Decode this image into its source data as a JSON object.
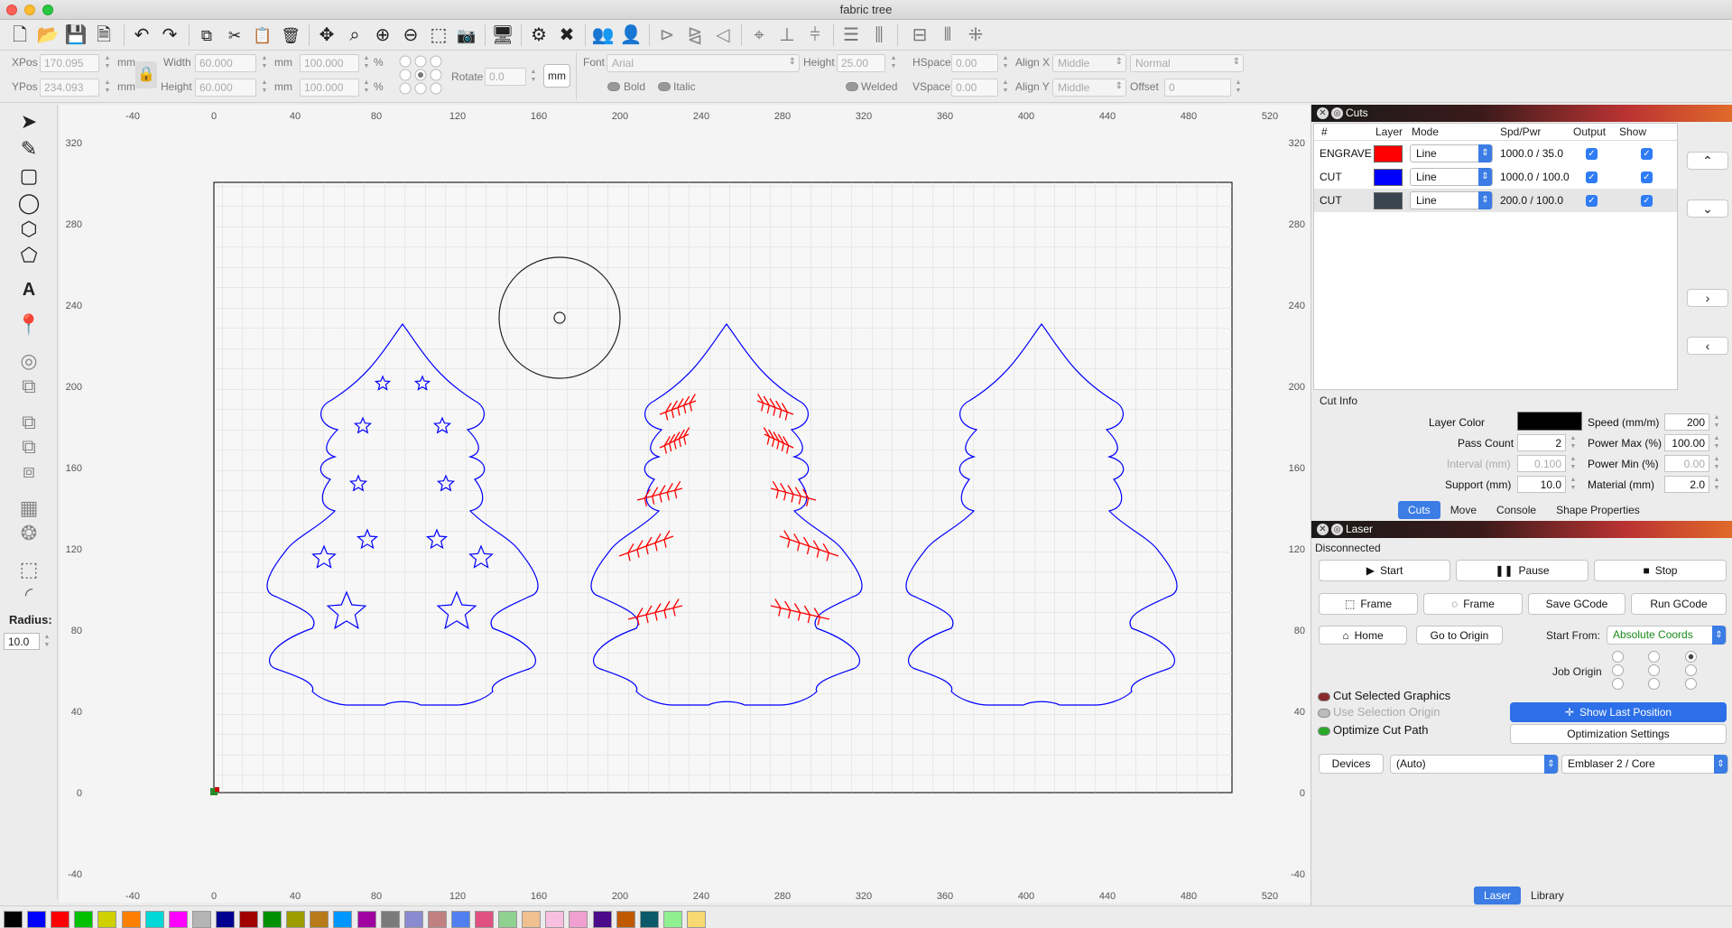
{
  "window": {
    "title": "fabric tree"
  },
  "toolbar": {
    "icons": [
      "new-file-icon",
      "open-file-icon",
      "save-icon",
      "save-as-icon",
      "undo-icon",
      "redo-icon",
      "copy-icon",
      "cut-icon",
      "paste-icon",
      "delete-icon",
      "move-icon",
      "zoom-fit-icon",
      "zoom-in-icon",
      "zoom-out-icon",
      "select-frame-icon",
      "camera-icon",
      "monitor-icon",
      "settings-icon",
      "tools-icon",
      "group-icon",
      "user-icon",
      "flip-h-icon",
      "mirror-icon",
      "arrange-icon",
      "target-icon",
      "align-left-icon",
      "align-center-icon",
      "dist-h-icon",
      "dist-v-icon",
      "resize-icon",
      "align-v-icon",
      "snap-icon"
    ]
  },
  "props": {
    "xpos_label": "XPos",
    "xpos_value": "170.095",
    "ypos_label": "YPos",
    "ypos_value": "234.093",
    "mm": "mm",
    "width_label": "Width",
    "width_value": "60.000",
    "height_label": "Height",
    "height_value": "60.000",
    "scale_w": "100.000",
    "scale_h": "100.000",
    "pct": "%",
    "rotate_label": "Rotate",
    "rotate_value": "0.0",
    "mm_button": "mm",
    "font_label": "Font",
    "font_value": "Arial",
    "font_height_label": "Height",
    "font_height_value": "25.00",
    "hspace_label": "HSpace",
    "hspace_value": "0.00",
    "vspace_label": "VSpace",
    "vspace_value": "0.00",
    "alignx_label": "Align X",
    "alignx_value": "Middle",
    "aligny_label": "Align Y",
    "aligny_value": "Middle",
    "normal_value": "Normal",
    "offset_label": "Offset",
    "offset_value": "0",
    "bold": "Bold",
    "italic": "Italic",
    "welded": "Welded"
  },
  "left_tools": {
    "icons": [
      "pointer-icon",
      "pencil-icon",
      "rectangle-icon",
      "ellipse-icon",
      "polygon-icon",
      "pentagon-icon",
      "text-icon",
      "position-pin-icon",
      "offset-icon",
      "boolean-icon",
      "weld-icon",
      "subtract-icon",
      "intersect-icon",
      "grid-array-icon",
      "circular-array-icon",
      "node-edit-icon",
      "corner-icon"
    ],
    "radius_label": "Radius:",
    "radius_value": "10.0"
  },
  "canvas": {
    "x_ticks": [
      "-40",
      "0",
      "40",
      "80",
      "120",
      "160",
      "200",
      "240",
      "280",
      "320",
      "360",
      "400",
      "440",
      "480",
      "520"
    ],
    "y_ticks": [
      "320",
      "280",
      "240",
      "200",
      "160",
      "120",
      "80",
      "40",
      "0",
      "-40"
    ]
  },
  "cuts_panel": {
    "title": "Cuts",
    "headers": {
      "num": "#",
      "layer": "Layer",
      "mode": "Mode",
      "spd": "Spd/Pwr",
      "output": "Output",
      "show": "Show"
    },
    "rows": [
      {
        "name": "ENGRAVE",
        "color": "#ff0000",
        "mode": "Line",
        "spd": "1000.0 / 35.0"
      },
      {
        "name": "CUT",
        "color": "#0000ff",
        "mode": "Line",
        "spd": "1000.0 / 100.0"
      },
      {
        "name": "CUT",
        "color": "#3a4550",
        "mode": "Line",
        "spd": "200.0 / 100.0"
      }
    ],
    "side_buttons": [
      "⌃",
      "⌄",
      "›",
      "‹"
    ],
    "cut_info": "Cut Info",
    "layer_color_label": "Layer Color",
    "speed_label": "Speed (mm/m)",
    "speed_value": "200",
    "pass_label": "Pass Count",
    "pass_value": "2",
    "pmax_label": "Power Max (%)",
    "pmax_value": "100.00",
    "interval_label": "Interval (mm)",
    "interval_value": "0.100",
    "pmin_label": "Power Min (%)",
    "pmin_value": "0.00",
    "support_label": "Support (mm)",
    "support_value": "10.0",
    "material_label": "Material (mm)",
    "material_value": "2.0",
    "tabs": [
      "Cuts",
      "Move",
      "Console",
      "Shape Properties"
    ]
  },
  "laser_panel": {
    "title": "Laser",
    "status": "Disconnected",
    "start": "Start",
    "pause": "Pause",
    "stop": "Stop",
    "frame1": "Frame",
    "frame2": "Frame",
    "save_gcode": "Save GCode",
    "run_gcode": "Run GCode",
    "home": "Home",
    "go_origin": "Go to Origin",
    "start_from_label": "Start From:",
    "start_from_value": "Absolute Coords",
    "job_origin_label": "Job Origin",
    "cut_selected": "Cut Selected Graphics",
    "use_sel_origin": "Use Selection Origin",
    "optimize": "Optimize Cut Path",
    "show_last": "Show Last Position",
    "opt_settings": "Optimization Settings",
    "devices": "Devices",
    "devices_value": "(Auto)",
    "machine_value": "Emblaser 2 / Core",
    "bottom_tabs": [
      "Laser",
      "Library"
    ]
  },
  "palette": [
    "#000000",
    "#0000ff",
    "#ff0000",
    "#00c000",
    "#d0d000",
    "#ff8000",
    "#00d8d8",
    "#ff00ff",
    "#b4b4b4",
    "#000090",
    "#a00000",
    "#009000",
    "#9c9c00",
    "#b87a1a",
    "#0096ff",
    "#a000a0",
    "#7a7a7a",
    "#8a8ad0",
    "#c08080",
    "#5080f0",
    "#e05080",
    "#90d090",
    "#f0c090",
    "#f8c0e0",
    "#f0a0d0",
    "#4a0a8a",
    "#c05a00",
    "#0a5a6a",
    "#90f090",
    "#f8d870"
  ]
}
